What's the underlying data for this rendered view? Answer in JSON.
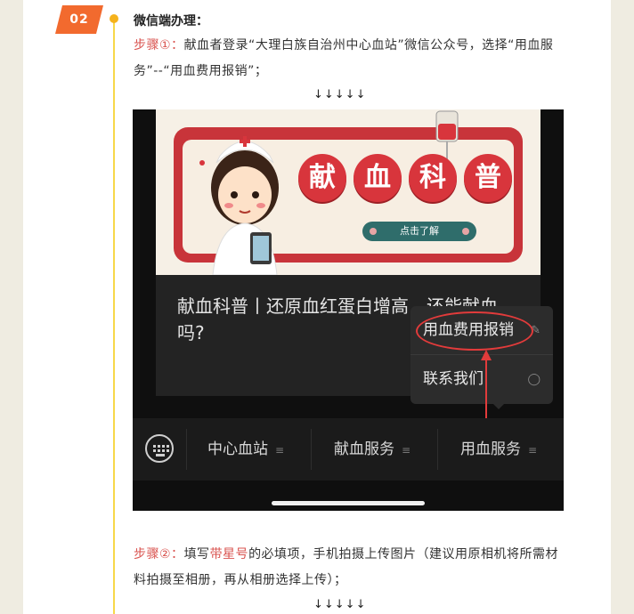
{
  "badge": "02",
  "section_title": "微信端办理：",
  "step1": {
    "label": "步骤①：",
    "text": "献血者登录“大理白族自治州中心血站”微信公众号，选择“用血服务”--“用血费用报销”；"
  },
  "arrows": "↓↓↓↓↓",
  "phone": {
    "banner": {
      "title_chars": [
        "献",
        "血",
        "科",
        "普"
      ],
      "button_label": "点击了解"
    },
    "article_title": "献血科普丨还原血红蛋白增高，还能献血吗?",
    "popup": {
      "items": [
        "用血费用报销",
        "联系我们"
      ]
    },
    "menu": {
      "items": [
        "中心血站",
        "献血服务",
        "用血服务"
      ]
    }
  },
  "step2": {
    "label": "步骤②：",
    "pre": "填写",
    "highlight": "带星号",
    "post": "的必填项，手机拍摄上传图片（建议用原相机将所需材料拍摄至相册，再从相册选择上传）；"
  },
  "colors": {
    "accent_red": "#d9534f",
    "badge_orange": "#f26a2e",
    "timeline_yellow": "#f7d84a",
    "page_side": "#efece1"
  }
}
